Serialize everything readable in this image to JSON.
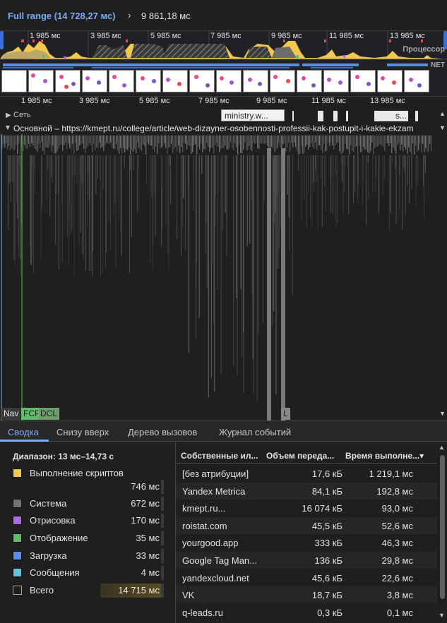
{
  "breadcrumb": {
    "full_range": "Full range (14 728,27 мс)",
    "current": "9 861,18 мс"
  },
  "overview": {
    "ticks": [
      "1 985 мс",
      "3 985 мс",
      "5 985 мс",
      "7 985 мс",
      "9 985 мс",
      "11 985 мс",
      "13 985 мс"
    ],
    "cpu_label": "Процессор",
    "net_label": "NET"
  },
  "ruler": {
    "ticks": [
      "1 985 мс",
      "3 985 мс",
      "5 985 мс",
      "7 985 мс",
      "9 985 мс",
      "11 985 мс",
      "13 985 мс"
    ]
  },
  "tracks": {
    "network_label": "Сеть",
    "network_tooltip": "ministry.w...",
    "network_tooltip2": "s...",
    "main_label": "Основной – https://kmept.ru/college/article/web-dizayner-osobennosti-professii-kak-postupit-i-kakie-ekzam"
  },
  "markers": {
    "nav": "Nav",
    "fcp": "FCP",
    "dcl": "DCL",
    "l": "L"
  },
  "tabs": [
    "Сводка",
    "Снизу вверх",
    "Дерево вызовов",
    "Журнал событий"
  ],
  "summary": {
    "range": "Диапазон: 13 мс–14,73 с",
    "items": [
      {
        "name": "Выполнение скриптов",
        "value": "746 мс",
        "color": "#f2c94c"
      },
      {
        "name": "Система",
        "value": "672 мс",
        "color": "#737373"
      },
      {
        "name": "Отрисовка",
        "value": "170 мс",
        "color": "#ab6ce2"
      },
      {
        "name": "Отображение",
        "value": "35 мс",
        "color": "#5ebd6a"
      },
      {
        "name": "Загрузка",
        "value": "33 мс",
        "color": "#5a8ee6"
      },
      {
        "name": "Сообщения",
        "value": "4 мс",
        "color": "#63c1dd"
      },
      {
        "name": "Всего",
        "value": "14 715 мс",
        "color": "#1f1f1f"
      }
    ]
  },
  "table": {
    "headers": [
      "Собственные ил...",
      "Объем переда...",
      "Время выполне...▾"
    ],
    "rows": [
      [
        "[без атрибуции]",
        "17,6 кБ",
        "1 219,1 мс"
      ],
      [
        "Yandex Metrica",
        "84,1 кБ",
        "192,8 мс"
      ],
      [
        "kmept.ru...",
        "16 074 кБ",
        "93,0 мс"
      ],
      [
        "roistat.com",
        "45,5 кБ",
        "52,6 мс"
      ],
      [
        "yourgood.app",
        "333 кБ",
        "46,3 мс"
      ],
      [
        "Google Tag Man...",
        "136 кБ",
        "29,8 мс"
      ],
      [
        "yandexcloud.net",
        "45,6 кБ",
        "22,6 мс"
      ],
      [
        "VK",
        "18,7 кБ",
        "3,8 мс"
      ],
      [
        "q-leads.ru",
        "0,3 кБ",
        "0,1 мс"
      ]
    ]
  }
}
